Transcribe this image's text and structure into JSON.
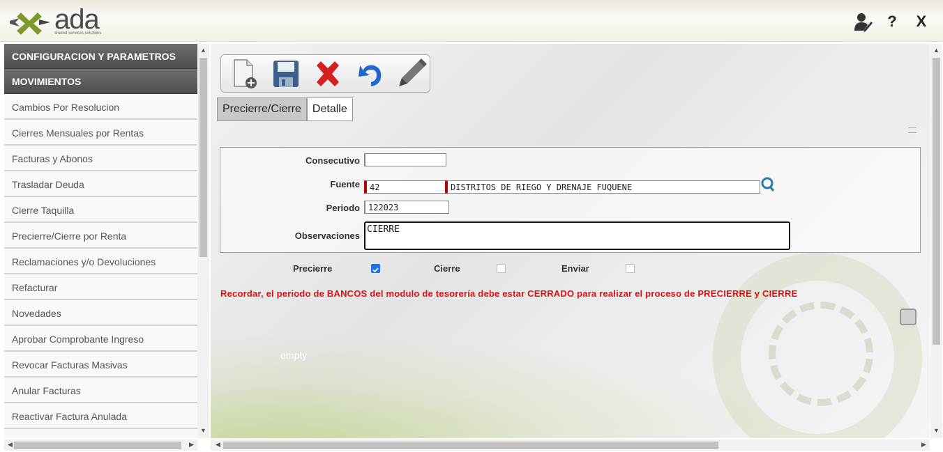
{
  "header": {
    "logo_text": "ada",
    "logo_tagline": "shared services solutions",
    "help_label": "?",
    "close_label": "X"
  },
  "sidebar": {
    "sections": [
      {
        "label": "CONFIGURACION Y PARAMETROS"
      },
      {
        "label": "MOVIMIENTOS"
      }
    ],
    "items": [
      {
        "label": "Cambios Por Resolucion"
      },
      {
        "label": "Cierres Mensuales por Rentas"
      },
      {
        "label": "Facturas y Abonos"
      },
      {
        "label": "Trasladar Deuda"
      },
      {
        "label": "Cierre Taquilla"
      },
      {
        "label": "Precierre/Cierre por Renta"
      },
      {
        "label": "Reclamaciones y/o Devoluciones"
      },
      {
        "label": "Refacturar"
      },
      {
        "label": "Novedades"
      },
      {
        "label": "Aprobar Comprobante Ingreso"
      },
      {
        "label": "Revocar Facturas Masivas"
      },
      {
        "label": "Anular Facturas"
      },
      {
        "label": "Reactivar Factura Anulada"
      }
    ]
  },
  "toolbar": {
    "icons": [
      "new-document-icon",
      "save-icon",
      "delete-icon",
      "undo-icon",
      "edit-icon"
    ]
  },
  "tabs": [
    {
      "label": "Precierre/Cierre",
      "active": true
    },
    {
      "label": "Detalle",
      "active": false
    }
  ],
  "form": {
    "consecutivo_label": "Consecutivo",
    "consecutivo_value": "",
    "fuente_label": "Fuente",
    "fuente_code": "42",
    "fuente_name": "DISTRITOS DE RIEGO Y DRENAJE FUQUENE",
    "periodo_label": "Periodo",
    "periodo_value": "122023",
    "observaciones_label": "Observaciones",
    "observaciones_value": "CIERRE"
  },
  "checks": {
    "precierre_label": "Precierre",
    "precierre_checked": true,
    "cierre_label": "Cierre",
    "cierre_checked": false,
    "enviar_label": "Enviar",
    "enviar_checked": false
  },
  "warning": "Recordar, el periodo de BANCOS del modulo de tesorería debe estar CERRADO para realizar el proceso de PRECIERRE y CIERRE",
  "empty_label": "empty",
  "colors": {
    "warning": "#e01010",
    "accent": "#1a73e8",
    "sidebar_header": "#555555"
  }
}
